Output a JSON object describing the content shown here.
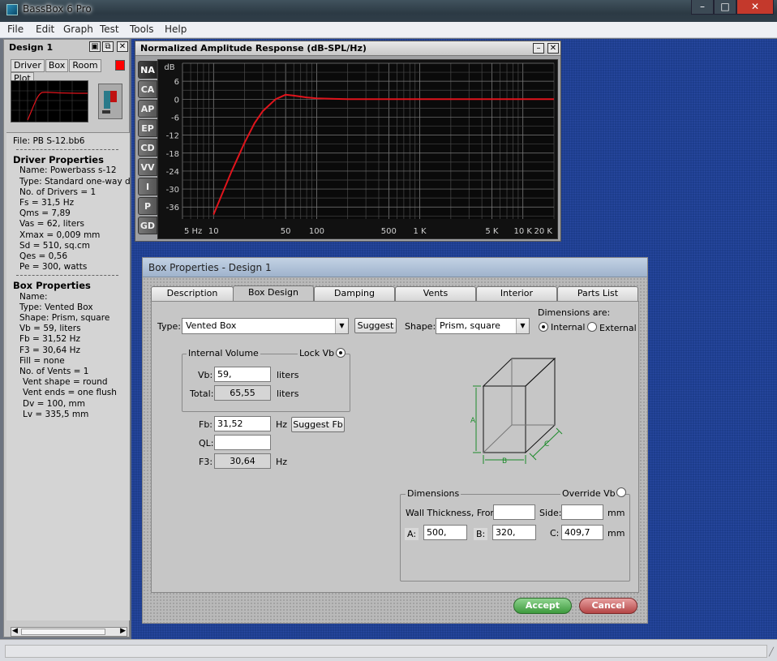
{
  "app": {
    "title": "BassBox 6 Pro"
  },
  "menu": [
    "File",
    "Edit",
    "Graph",
    "Test",
    "Tools",
    "Help"
  ],
  "design_panel": {
    "title": "Design 1",
    "tabs": [
      "Driver",
      "Box",
      "Room",
      "Plot"
    ],
    "file": "File:  PB S-12.bb6",
    "driver_heading": "Driver Properties",
    "driver_lines": [
      "Name: Powerbass s-12",
      "Type: Standard one-way driver",
      "No. of Drivers = 1",
      "Fs =  31,5 Hz",
      "Qms =  7,89",
      "Vas =  62, liters",
      "Xmax =  0,009 mm",
      "Sd =  510, sq.cm",
      "Qes =  0,56",
      "Pe =  300, watts"
    ],
    "box_heading": "Box Properties",
    "box_lines": [
      "Name:",
      "Type: Vented Box",
      "Shape: Prism, square",
      "Vb =  59, liters",
      "Fb =  31,52 Hz",
      "F3 =  30,64 Hz",
      "Fill = none",
      "No. of Vents = 1"
    ],
    "vent_lines": [
      "Vent shape = round",
      "Vent ends = one flush",
      "Dv =  100, mm",
      "Lv =  335,5 mm"
    ]
  },
  "graph": {
    "title": "Normalized Amplitude Response (dB-SPL/Hz)",
    "tabs": [
      "NA",
      "CA",
      "AP",
      "EP",
      "CD",
      "VV",
      "I",
      "P",
      "GD"
    ]
  },
  "chart_data": {
    "type": "line",
    "title": "Normalized Amplitude Response (dB-SPL/Hz)",
    "xlabel": "",
    "ylabel": "dB",
    "x_scale": "log",
    "xlim": [
      5,
      20000
    ],
    "ylim": [
      -40,
      12
    ],
    "x_ticks": [
      "5 Hz",
      "10",
      "50",
      "100",
      "500",
      "1 K",
      "5 K",
      "10 K",
      "20 K"
    ],
    "y_ticks": [
      "6",
      "0",
      "-6",
      "-12",
      "-18",
      "-24",
      "-30",
      "-36"
    ],
    "series": [
      {
        "x": [
          10,
          12,
          15,
          20,
          25,
          30,
          40,
          50,
          60,
          80,
          100,
          150,
          200,
          500,
          1000,
          5000,
          20000
        ],
        "y": [
          -38.5,
          -32,
          -24,
          -14.5,
          -8,
          -4,
          0,
          1.5,
          1.2,
          0.6,
          0.3,
          0.1,
          0,
          0,
          0,
          0,
          0
        ],
        "color": "#e0141c"
      }
    ],
    "grid": true
  },
  "dialog": {
    "title": "Box Properties - Design 1",
    "tabs": [
      "Description",
      "Box Design",
      "Damping",
      "Vents",
      "Interior",
      "Parts List"
    ],
    "type_label": "Type:",
    "type_value": "Vented Box",
    "suggest_label": "Suggest",
    "shape_label": "Shape:",
    "shape_value": "Prism, square",
    "dims_are_label": "Dimensions are:",
    "internal_label": "Internal",
    "external_label": "External",
    "internal_volume_label": "Internal Volume",
    "lock_vb_label": "Lock Vb",
    "vb_label": "Vb:",
    "vb_value": "59,",
    "total_label": "Total:",
    "total_value": "65,55",
    "liters": "liters",
    "fb_label": "Fb:",
    "fb_value": "31,52",
    "hz": "Hz",
    "suggest_fb_label": "Suggest Fb",
    "ql_label": "QL:",
    "ql_value": "",
    "f3_label": "F3:",
    "f3_value": "30,64",
    "dimensions_label": "Dimensions",
    "override_vb_label": "Override Vb",
    "wall_label": "Wall Thickness, Front:",
    "side_label": "Side:",
    "mm": "mm",
    "a_label": "A:",
    "a_value": "500,",
    "b_label": "B:",
    "b_value": "320,",
    "c_label": "C:",
    "c_value": "409,7",
    "front_value": "",
    "side_value": "",
    "accept_label": "Accept",
    "cancel_label": "Cancel",
    "box_diagram_labels": [
      "A",
      "B",
      "C"
    ]
  }
}
